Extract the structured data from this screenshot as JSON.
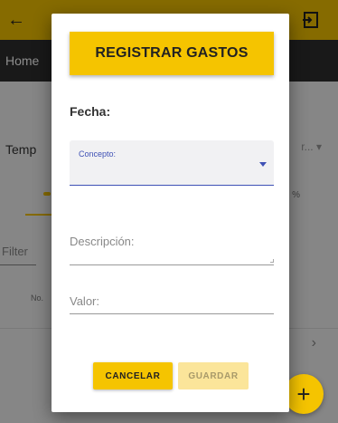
{
  "app": {
    "nav_home_label": "Home",
    "select_label": "Temp",
    "select_value_partial": "r...",
    "percent_label": "%",
    "filter_placeholder": "Filter",
    "column_no": "No.",
    "chevron": "›",
    "fab_label": "+"
  },
  "dialog": {
    "title": "REGISTRAR GASTOS",
    "fecha_label": "Fecha:",
    "concepto_label": "Concepto:",
    "descripcion_label": "Descripción:",
    "valor_label": "Valor:",
    "cancel_label": "CANCELAR",
    "save_label": "GUARDAR"
  },
  "colors": {
    "accent": "#f5c400",
    "primary_input": "#3f51b5",
    "toolbar_dark": "#2f2f2f"
  },
  "icons": {
    "back": "arrow-left-icon",
    "logout": "logout-icon",
    "dropdown": "dropdown-arrow-icon",
    "add": "plus-icon"
  }
}
